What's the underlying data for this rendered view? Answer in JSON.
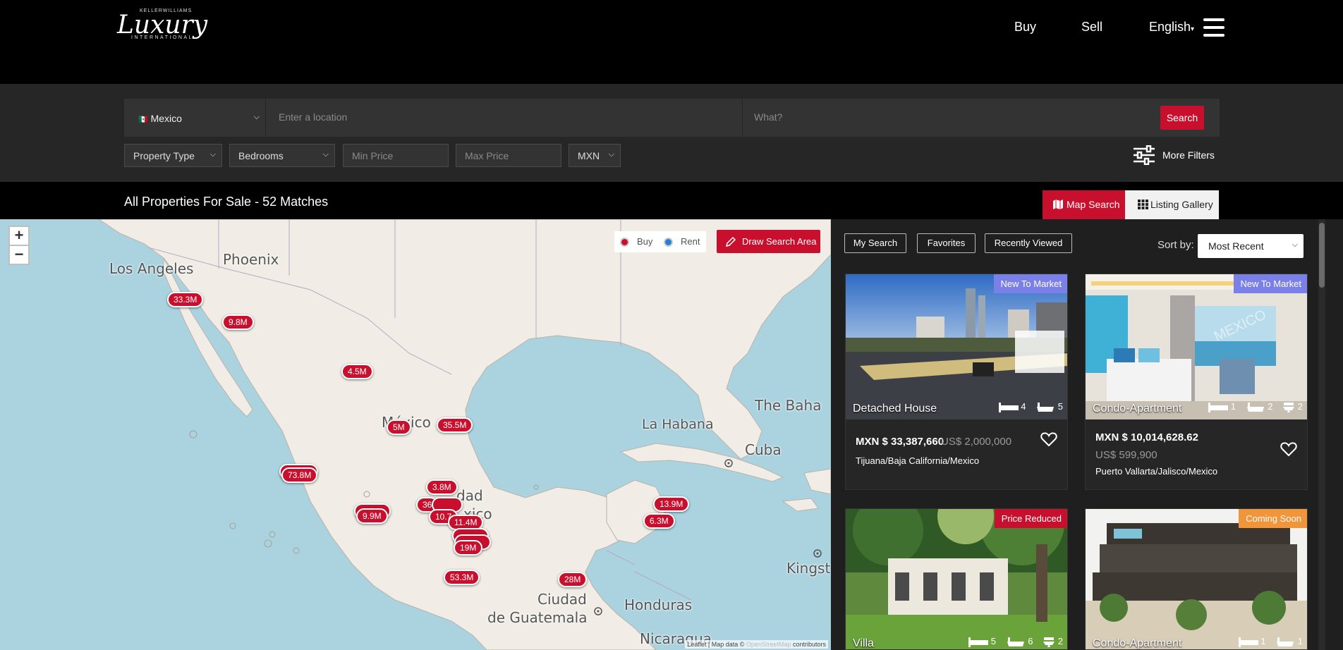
{
  "header": {
    "logo": {
      "top": "KELLERWILLIAMS",
      "script": "Luxury",
      "sub": "INTERNATIONAL"
    },
    "nav": {
      "buy": "Buy",
      "sell": "Sell",
      "language": "English",
      "language_caret": "▾"
    }
  },
  "search": {
    "country": "Mexico",
    "country_flag": "🇲🇽",
    "location_placeholder": "Enter a location",
    "what_placeholder": "What?",
    "search_label": "Search",
    "property_type": "Property Type",
    "bedrooms": "Bedrooms",
    "min_price_placeholder": "Min Price",
    "max_price_placeholder": "Max Price",
    "currency": "MXN",
    "more_filters": "More Filters"
  },
  "results": {
    "title": "All Properties For Sale - 52 Matches",
    "map_search": "Map Search",
    "listing_gallery": "Listing Gallery"
  },
  "map": {
    "zoom_in": "+",
    "zoom_out": "−",
    "legend_buy": "Buy",
    "legend_rent": "Rent",
    "draw_area": "Draw Search Area",
    "attribution_prefix": "Leaflet | Map data ©",
    "attribution_link": "OpenStreetMap",
    "attribution_suffix": "contributors",
    "places": [
      "Los Angeles",
      "Phoenix",
      "México",
      "La Habana",
      "The Baha",
      "Cuba",
      "Ciudad",
      "de Guatemala",
      "Honduras",
      "Nicaragua",
      "Kingst",
      "dad",
      "xico"
    ],
    "markers": [
      "33.3M",
      "9.8M",
      "4.5M",
      "5M",
      "35.5M",
      "73.8M",
      "3.8M",
      "9.9M",
      "36",
      "10.7",
      "11.4M",
      "19M",
      "53.3M",
      "28M",
      "13.9M",
      "6.3M"
    ]
  },
  "panel": {
    "tabs": [
      "My Search",
      "Favorites",
      "Recently Viewed"
    ],
    "sort_label": "Sort by:",
    "sort_value": "Most Recent",
    "listings": [
      {
        "badge": "New To Market",
        "badge_color": "#7b7fe8",
        "type": "Detached House",
        "beds": "4",
        "baths": "5",
        "price_mxn": "MXN $ 33,387,660",
        "price_usd": "US$ 2,000,000",
        "location": "Tijuana/Baja California/Mexico"
      },
      {
        "badge": "New To Market",
        "badge_color": "#7b7fe8",
        "type": "Condo-Apartment",
        "beds": "1",
        "baths": "2",
        "half_baths": "2",
        "price_mxn": "MXN $ 10,014,628.62",
        "price_usd": "US$ 599,900",
        "location": "Puerto Vallarta/Jalisco/Mexico",
        "watermark": "MEXICO"
      },
      {
        "badge": "Price Reduced",
        "badge_color": "#c8102e",
        "type": "Villa",
        "beds": "5",
        "baths": "6",
        "half_baths": "2"
      },
      {
        "badge": "Coming Soon",
        "badge_color": "#f0953a",
        "type": "Condo-Apartment",
        "beds": "1",
        "baths": "1"
      }
    ]
  }
}
